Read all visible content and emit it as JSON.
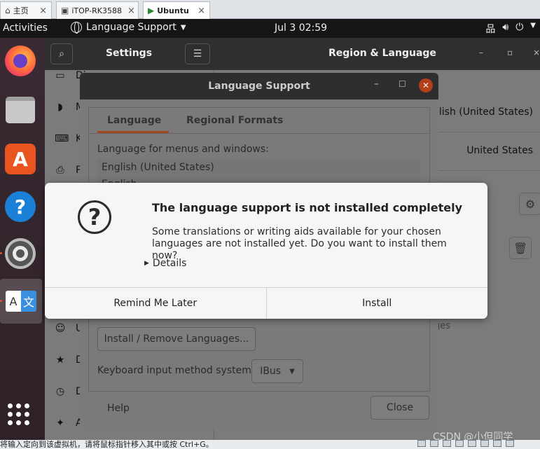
{
  "vm_tabs": [
    {
      "label": "主页",
      "icon": "home-icon"
    },
    {
      "label": "iTOP-RK3588",
      "icon": "vm-icon"
    },
    {
      "label": "Ubuntu",
      "icon": "vm-icon"
    }
  ],
  "topbar": {
    "activities": "Activities",
    "app_menu": "Language Support",
    "clock": "Jul 3  02:59"
  },
  "settings": {
    "title": "Settings",
    "panel_title": "Region & Language",
    "sidebar_items": [
      "Di",
      "M",
      "K",
      "P",
      "U",
      "D",
      "D",
      "A"
    ],
    "language_value": "glish (United States)",
    "formats_value": "United States",
    "hint_text": "ges"
  },
  "language_support": {
    "title": "Language Support",
    "tabs": [
      "Language",
      "Regional Formats"
    ],
    "menus_label": "Language for menus and windows:",
    "languages": [
      "English (United States)",
      "English"
    ],
    "install_remove_button": "Install / Remove Languages...",
    "keyboard_label": "Keyboard input method system:",
    "keyboard_value": "IBus",
    "help_button": "Help",
    "close_button": "Close"
  },
  "alert": {
    "title": "The language support is not installed completely",
    "body": "Some translations or writing aids available for your chosen languages are not installed yet. Do you want to install them now?",
    "details": "Details",
    "remind_button": "Remind Me Later",
    "install_button": "Install"
  },
  "statusbar": {
    "hint": "将输入定向到该虚拟机，请将鼠标指针移入其中或按 Ctrl+G。"
  },
  "watermark": "CSDN @小但同学"
}
